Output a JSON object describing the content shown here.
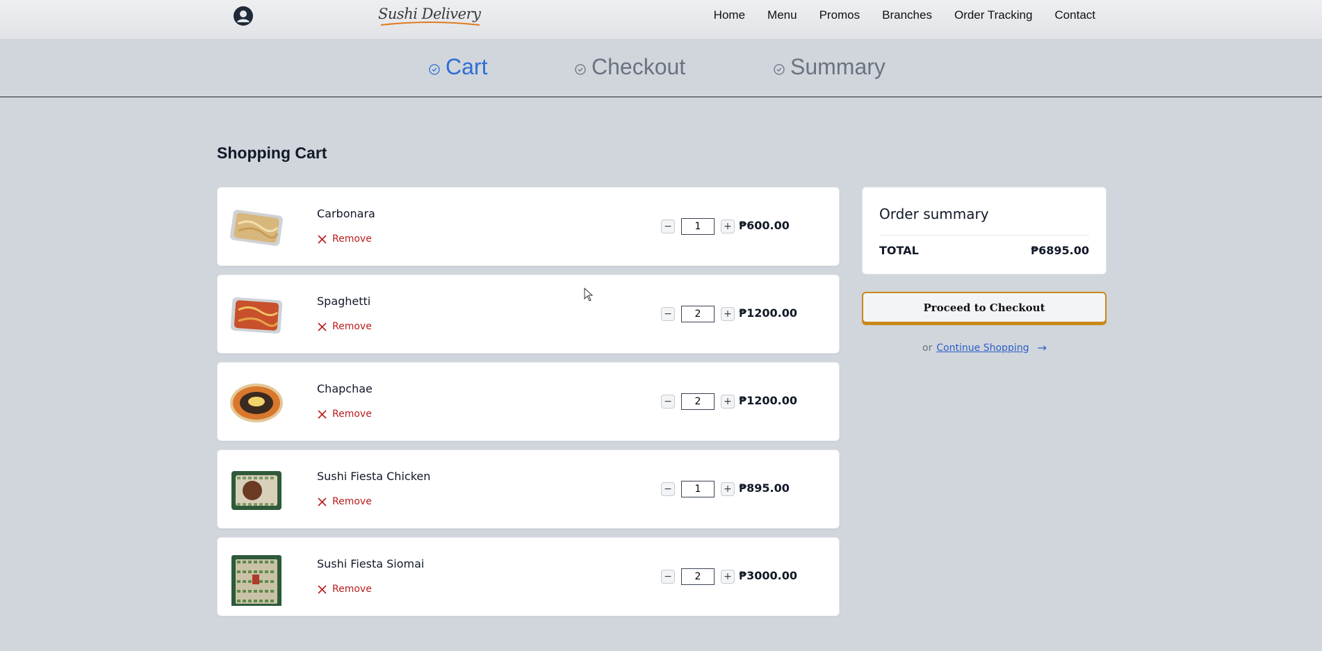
{
  "brand": {
    "logo_text": "Sushi Delivery"
  },
  "nav": {
    "items": [
      "Home",
      "Menu",
      "Promos",
      "Branches",
      "Order Tracking",
      "Contact"
    ]
  },
  "stepper": {
    "steps": [
      {
        "label": "Cart",
        "active": true
      },
      {
        "label": "Checkout",
        "active": false
      },
      {
        "label": "Summary",
        "active": false
      }
    ]
  },
  "page_title": "Shopping Cart",
  "remove_label": "Remove",
  "cart_items": [
    {
      "name": "Carbonara",
      "qty": "1",
      "price": "₱600.00"
    },
    {
      "name": "Spaghetti",
      "qty": "2",
      "price": "₱1200.00"
    },
    {
      "name": "Chapchae",
      "qty": "2",
      "price": "₱1200.00"
    },
    {
      "name": "Sushi Fiesta Chicken",
      "qty": "1",
      "price": "₱895.00"
    },
    {
      "name": "Sushi Fiesta Siomai",
      "qty": "2",
      "price": "₱3000.00"
    }
  ],
  "summary": {
    "title": "Order summary",
    "total_label": "TOTAL",
    "total_value": "₱6895.00"
  },
  "checkout_button": "Proceed to Checkout",
  "continue": {
    "prefix": "or",
    "link": "Continue Shopping",
    "arrow": "→"
  },
  "colors": {
    "accent": "#2b6fd6",
    "remove": "#b91c1c",
    "button_border": "#c88a1a"
  }
}
